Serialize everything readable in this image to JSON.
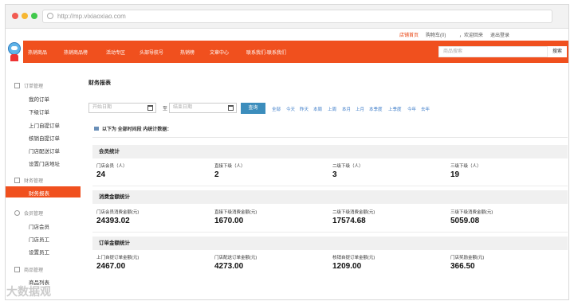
{
  "browser": {
    "url": "http://mp.vixiaoxiao.com"
  },
  "toplinks": {
    "shop_home": "店铺首页",
    "cart": "购物车(0)",
    "welcome": "，欢迎回来",
    "logout": "退出登录"
  },
  "nav": {
    "items": [
      "热销商品",
      "热销商品榜",
      "活动专区",
      "头部导航号",
      "热销榜",
      "文章中心",
      "联系我们-联系我们"
    ],
    "search_placeholder": "商品搜索",
    "search_button": "搜索"
  },
  "sidebar": {
    "groups": [
      {
        "title": "订单管理",
        "items": [
          "我的订单",
          "下级订单",
          "上门自提订单",
          "核销自提订单",
          "门店配送订单",
          "设置门店地址"
        ]
      },
      {
        "title": "财务管理",
        "items": [
          "财务报表"
        ]
      },
      {
        "title": "会员管理",
        "items": [
          "门店会员",
          "门店员工",
          "设置员工"
        ]
      },
      {
        "title": "商品管理",
        "items": [
          "商品列表"
        ]
      }
    ],
    "active": "财务报表"
  },
  "main": {
    "title": "财务报表",
    "start_placeholder": "开始日期",
    "end_placeholder": "结束日期",
    "to_label": "至",
    "query_button": "查询",
    "quick_filters": [
      "全部",
      "今天",
      "昨天",
      "本周",
      "上周",
      "本月",
      "上月",
      "本季度",
      "上季度",
      "今年",
      "去年"
    ],
    "notice": "以下为 全部时间段 内统计数据：",
    "sections": [
      {
        "title": "会员统计",
        "stats": [
          {
            "label": "门店会员（人）",
            "value": "24"
          },
          {
            "label": "直接下级（人）",
            "value": "2"
          },
          {
            "label": "二级下级（人）",
            "value": "3"
          },
          {
            "label": "三级下级（人）",
            "value": "19"
          }
        ]
      },
      {
        "title": "消费金额统计",
        "stats": [
          {
            "label": "门店会员消费金额(元)",
            "value": "24393.02"
          },
          {
            "label": "直接下级消费金额(元)",
            "value": "1670.00"
          },
          {
            "label": "二级下级消费金额(元)",
            "value": "17574.68"
          },
          {
            "label": "三级下级消费金额(元)",
            "value": "5059.08"
          }
        ]
      },
      {
        "title": "订单金额统计",
        "stats": [
          {
            "label": "上门自提订单金额(元)",
            "value": "2467.00"
          },
          {
            "label": "门店配送订单金额(元)",
            "value": "4273.00"
          },
          {
            "label": "核销自提订单金额(元)",
            "value": "1209.00"
          },
          {
            "label": "门店奖励金额(元)",
            "value": "366.50"
          }
        ]
      }
    ]
  },
  "watermark": "大数据观"
}
